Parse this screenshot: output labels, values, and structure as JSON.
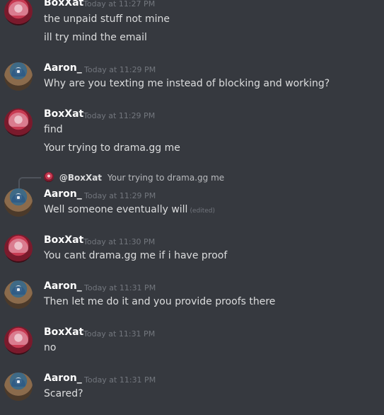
{
  "messages": [
    {
      "author": "BoxXat",
      "time": "Today at 11:27 PM",
      "lines": [
        "the unpaid stuff not mine",
        "ill try mind the email"
      ]
    },
    {
      "author": "Aaron_",
      "time": "Today at 11:29 PM",
      "lines": [
        "Why are you texting me instead of blocking and working?"
      ]
    },
    {
      "author": "BoxXat",
      "time": "Today at 11:29 PM",
      "lines": [
        "find",
        "Your trying to drama.gg me"
      ]
    },
    {
      "author": "Aaron_",
      "time": "Today at 11:29 PM",
      "reply": {
        "mention": "@BoxXat",
        "text": "Your trying to drama.gg me"
      },
      "lines": [
        "Well someone eventually will"
      ],
      "edited": "(edited)"
    },
    {
      "author": "BoxXat",
      "time": "Today at 11:30 PM",
      "lines": [
        "You cant drama.gg me if i have proof"
      ]
    },
    {
      "author": "Aaron_",
      "time": "Today at 11:31 PM",
      "lines": [
        "Then let me do it and you provide proofs there"
      ]
    },
    {
      "author": "BoxXat",
      "time": "Today at 11:31 PM",
      "lines": [
        "no"
      ]
    },
    {
      "author": "Aaron_",
      "time": "Today at 11:31 PM",
      "lines": [
        "Scared?"
      ]
    }
  ]
}
